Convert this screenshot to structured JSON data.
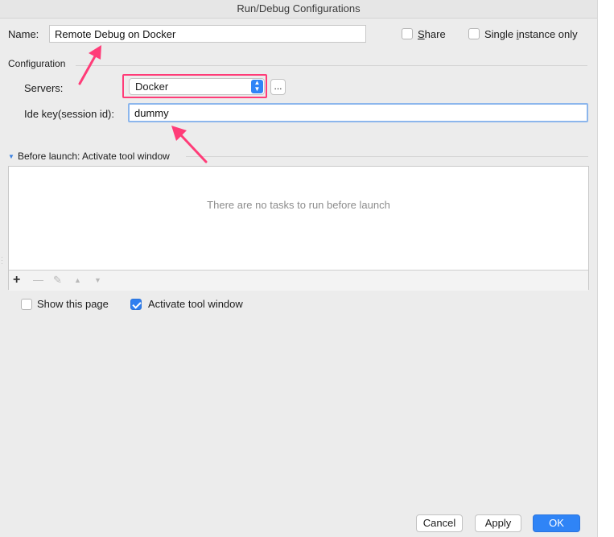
{
  "window": {
    "title": "Run/Debug Configurations"
  },
  "name_row": {
    "label": "Name:",
    "value": "Remote Debug on Docker",
    "share_label": "Share",
    "share_checked": false,
    "single_instance_label": "Single instance only",
    "single_instance_checked": false
  },
  "configuration": {
    "section_label": "Configuration",
    "servers_label": "Servers:",
    "servers_value": "Docker",
    "browse_label": "...",
    "ide_key_label": "Ide key(session id):",
    "ide_key_value": "dummy"
  },
  "before_launch": {
    "header": "Before launch: Activate tool window",
    "empty_text": "There are no tasks to run before launch",
    "toolbar_icons": [
      "add-icon",
      "remove-icon",
      "edit-icon",
      "move-up-icon",
      "move-down-icon"
    ]
  },
  "options": {
    "show_page_label": "Show this page",
    "show_page_checked": false,
    "activate_tool_label": "Activate tool window",
    "activate_tool_checked": true
  },
  "buttons": {
    "cancel": "Cancel",
    "apply": "Apply",
    "ok": "OK"
  },
  "colors": {
    "accent": "#2f84f6",
    "annotation": "#ff3c78"
  }
}
